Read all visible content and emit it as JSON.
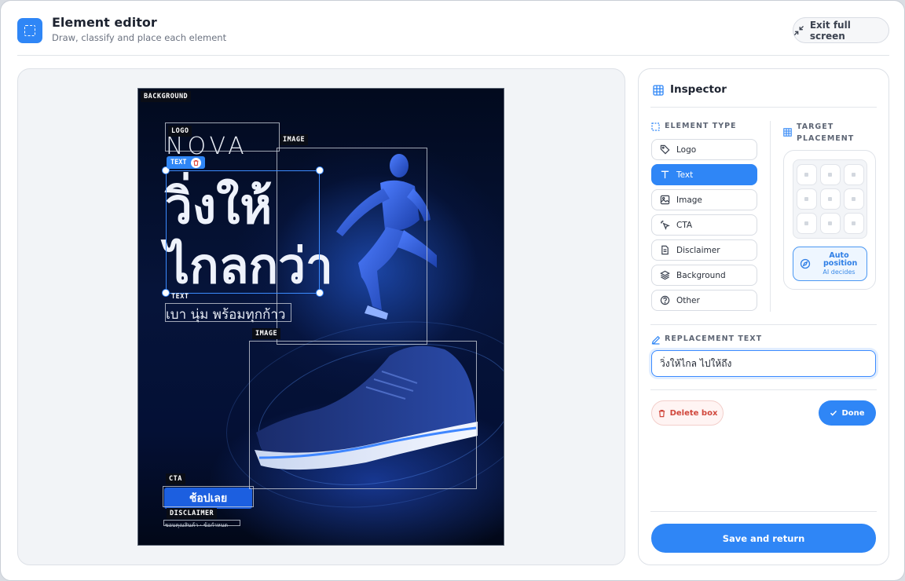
{
  "header": {
    "title": "Element editor",
    "subtitle": "Draw, classify and place each element",
    "exit_label": "Exit full screen"
  },
  "poster": {
    "labels": {
      "background": "BACKGROUND",
      "logo": "LOGO",
      "image1": "IMAGE",
      "text_selected": "TEXT",
      "text2": "TEXT",
      "image2": "IMAGE",
      "cta": "CTA",
      "disclaimer": "DISCLAIMER"
    },
    "logo_text": "NOVA",
    "headline_line1": "วิ่งให้",
    "headline_line2": "ไกลกว่า",
    "subline": "เบา นุ่ม พร้อมทุกก้าว",
    "cta_text": "ช้อปเลย",
    "disclaimer_text": "ขอบคุณสินค้า · ข้อกำหนด"
  },
  "inspector": {
    "title": "Inspector",
    "element_type_label": "ELEMENT TYPE",
    "target_placement_label": "TARGET PLACEMENT",
    "types": [
      {
        "label": "Logo",
        "icon": "tag-icon",
        "active": false
      },
      {
        "label": "Text",
        "icon": "text-icon",
        "active": true
      },
      {
        "label": "Image",
        "icon": "image-icon",
        "active": false
      },
      {
        "label": "CTA",
        "icon": "cursor-click-icon",
        "active": false
      },
      {
        "label": "Disclaimer",
        "icon": "document-icon",
        "active": false
      },
      {
        "label": "Background",
        "icon": "layers-icon",
        "active": false
      },
      {
        "label": "Other",
        "icon": "help-circle-icon",
        "active": false
      }
    ],
    "auto_title": "Auto position",
    "auto_sub": "AI decides",
    "replacement_label": "REPLACEMENT TEXT",
    "replacement_value": "วิ่งให้ไกล ไปให้ถึง",
    "delete_label": "Delete box",
    "done_label": "Done",
    "save_label": "Save and return"
  },
  "colors": {
    "accent": "#2f86f6",
    "danger": "#d0463b",
    "poster_bg": "#041035"
  }
}
